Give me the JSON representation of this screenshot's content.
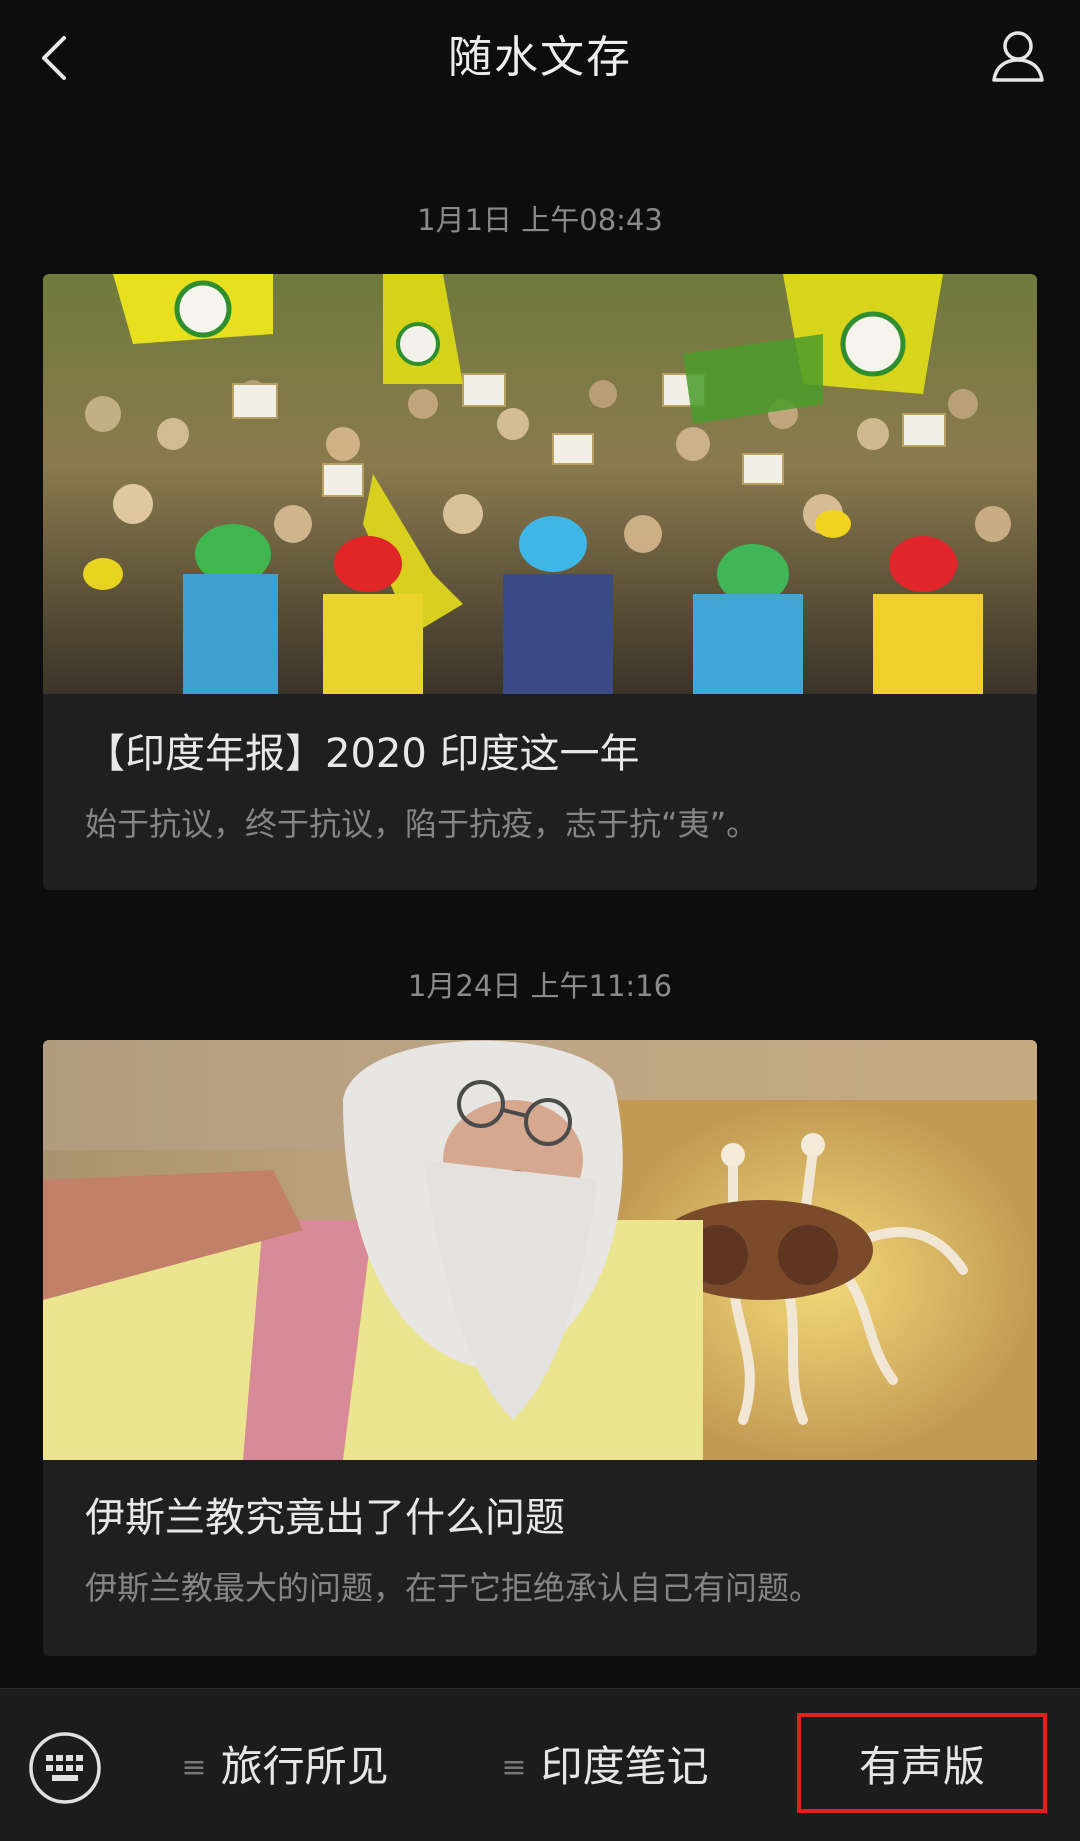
{
  "header": {
    "title": "随水文存",
    "back_icon": "chevron-left-icon",
    "profile_icon": "person-icon"
  },
  "messages": [
    {
      "timestamp": "1月1日 上午08:43",
      "title": "【印度年报】2020 印度这一年",
      "description": "始于抗议，终于抗议，陷于抗疫，志于抗“夷”。"
    },
    {
      "timestamp": "1月24日 上午11:16",
      "title": "伊斯兰教究竟出了什么问题",
      "description": "伊斯兰教最大的问题，在于它拒绝承认自己有问题。"
    }
  ],
  "bottom_menu": {
    "keyboard_icon": "keyboard-icon",
    "items": [
      {
        "label": "旅行所见",
        "glyph": "≡"
      },
      {
        "label": "印度笔记",
        "glyph": "≡"
      },
      {
        "label": "有声版"
      }
    ]
  },
  "colors": {
    "background": "#0d0d0d",
    "card": "#1f1f1f",
    "highlight": "#e32018"
  }
}
